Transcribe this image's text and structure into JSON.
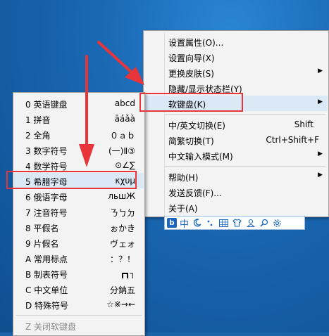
{
  "main_menu": {
    "items": [
      {
        "label": "设置属性(O)..."
      },
      {
        "label": "设置向导(X)"
      },
      {
        "label": "更换皮肤(S)"
      },
      {
        "label": "隐藏/显示状态栏(Y)"
      },
      {
        "label": "软键盘(K)"
      },
      {
        "label": "中/英文切换(E)",
        "shortcut": "Shift"
      },
      {
        "label": "简繁切换(T)",
        "shortcut": "Ctrl+Shift+F"
      },
      {
        "label": "中文输入模式(M)"
      },
      {
        "label": "帮助(H)"
      },
      {
        "label": "发送反馈(F)..."
      },
      {
        "label": "关于(A)"
      }
    ]
  },
  "soft_keyboard_menu": {
    "items": [
      {
        "label": "0 英语键盘",
        "sample": "abcd"
      },
      {
        "label": "1 拼音",
        "sample": "āáǎà"
      },
      {
        "label": "2 全角",
        "sample": "０ａｂ"
      },
      {
        "label": "3 数字符号",
        "sample": "(一)Ⅱ③"
      },
      {
        "label": "4 数学符号",
        "sample": "⊙∠∑"
      },
      {
        "label": "5 希腊字母",
        "sample": "κχυμ"
      },
      {
        "label": "6 俄语字母",
        "sample": "льшЖ"
      },
      {
        "label": "7 注音符号",
        "sample": "ㄋㄅㄉ"
      },
      {
        "label": "8 平假名",
        "sample": "ぉかき"
      },
      {
        "label": "9 片假名",
        "sample": "ヴェォ"
      },
      {
        "label": "A 常用标点",
        "sample": "：？！"
      },
      {
        "label": "B 制表符号",
        "sample": "┏┓┐"
      },
      {
        "label": "C 中文单位",
        "sample": "分鈉五"
      },
      {
        "label": "D 特殊符号",
        "sample": "☆※→←"
      },
      {
        "label": "Z 关闭软键盘"
      }
    ]
  },
  "ime_toolbar": {
    "logo": "b",
    "mode": "中",
    "icons": [
      "moon-icon",
      "punctuation-icon",
      "keyboard-icon",
      "shirt-icon",
      "user-icon",
      "search-icon",
      "gear-icon"
    ]
  },
  "colors": {
    "highlight": "#dbe8f6",
    "annotation_red": "#e8353a",
    "brand_blue": "#1a66c2"
  }
}
